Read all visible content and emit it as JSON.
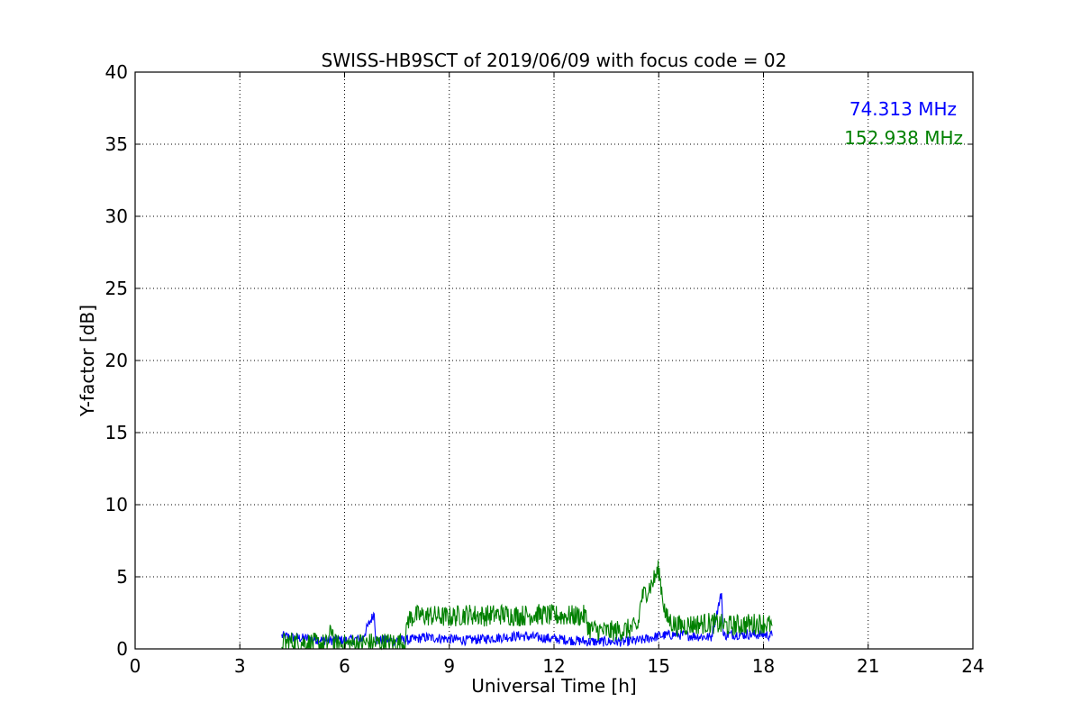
{
  "chart_data": {
    "type": "line",
    "title": "SWISS-HB9SCT of 2019/06/09 with focus code = 02",
    "xlabel": "Universal Time [h]",
    "ylabel": "Y-factor [dB]",
    "xlim": [
      0,
      24
    ],
    "ylim": [
      0,
      40
    ],
    "xticks": [
      0,
      3,
      6,
      9,
      12,
      15,
      18,
      21,
      24
    ],
    "yticks": [
      0,
      5,
      10,
      15,
      20,
      25,
      30,
      35,
      40
    ],
    "grid": true,
    "legend_position": "top-right",
    "series": [
      {
        "name": "74.313 MHz",
        "color": "#0000ff",
        "points": [
          [
            4.2,
            0.9
          ],
          [
            4.5,
            0.8
          ],
          [
            5.0,
            0.7
          ],
          [
            5.5,
            0.6
          ],
          [
            6.0,
            0.6
          ],
          [
            6.5,
            0.7
          ],
          [
            6.85,
            2.5
          ],
          [
            6.9,
            0.6
          ],
          [
            7.3,
            0.6
          ],
          [
            7.8,
            0.6
          ],
          [
            8.3,
            0.8
          ],
          [
            9.0,
            0.7
          ],
          [
            9.5,
            0.6
          ],
          [
            10.0,
            0.7
          ],
          [
            10.5,
            0.8
          ],
          [
            11.0,
            0.9
          ],
          [
            11.5,
            0.8
          ],
          [
            12.0,
            0.7
          ],
          [
            12.5,
            0.6
          ],
          [
            13.0,
            0.5
          ],
          [
            13.5,
            0.5
          ],
          [
            14.0,
            0.5
          ],
          [
            14.5,
            0.6
          ],
          [
            15.0,
            0.9
          ],
          [
            15.5,
            1.0
          ],
          [
            16.0,
            0.9
          ],
          [
            16.5,
            0.8
          ],
          [
            16.8,
            3.9
          ],
          [
            16.85,
            0.9
          ],
          [
            17.0,
            1.0
          ],
          [
            17.5,
            1.0
          ],
          [
            18.0,
            1.0
          ],
          [
            18.25,
            0.9
          ]
        ]
      },
      {
        "name": "152.938 MHz",
        "color": "#008000",
        "points": [
          [
            4.2,
            0.4
          ],
          [
            4.5,
            0.5
          ],
          [
            5.0,
            0.4
          ],
          [
            5.5,
            0.3
          ],
          [
            5.65,
            1.5
          ],
          [
            5.7,
            0.3
          ],
          [
            6.0,
            0.3
          ],
          [
            6.5,
            0.4
          ],
          [
            7.0,
            0.4
          ],
          [
            7.5,
            0.4
          ],
          [
            7.75,
            0.5
          ],
          [
            7.8,
            2.0
          ],
          [
            8.0,
            2.3
          ],
          [
            8.5,
            2.3
          ],
          [
            9.0,
            2.2
          ],
          [
            9.5,
            2.4
          ],
          [
            10.0,
            2.3
          ],
          [
            10.5,
            2.4
          ],
          [
            11.0,
            2.3
          ],
          [
            11.5,
            2.4
          ],
          [
            12.0,
            2.3
          ],
          [
            12.5,
            2.3
          ],
          [
            12.9,
            2.3
          ],
          [
            13.0,
            1.4
          ],
          [
            13.5,
            1.2
          ],
          [
            14.0,
            1.3
          ],
          [
            14.4,
            1.5
          ],
          [
            14.5,
            3.5
          ],
          [
            14.8,
            4.5
          ],
          [
            15.0,
            5.5
          ],
          [
            15.2,
            2.2
          ],
          [
            15.5,
            1.6
          ],
          [
            16.0,
            1.7
          ],
          [
            16.5,
            1.8
          ],
          [
            17.0,
            1.6
          ],
          [
            17.5,
            1.7
          ],
          [
            18.0,
            1.8
          ],
          [
            18.25,
            1.6
          ]
        ]
      }
    ]
  }
}
